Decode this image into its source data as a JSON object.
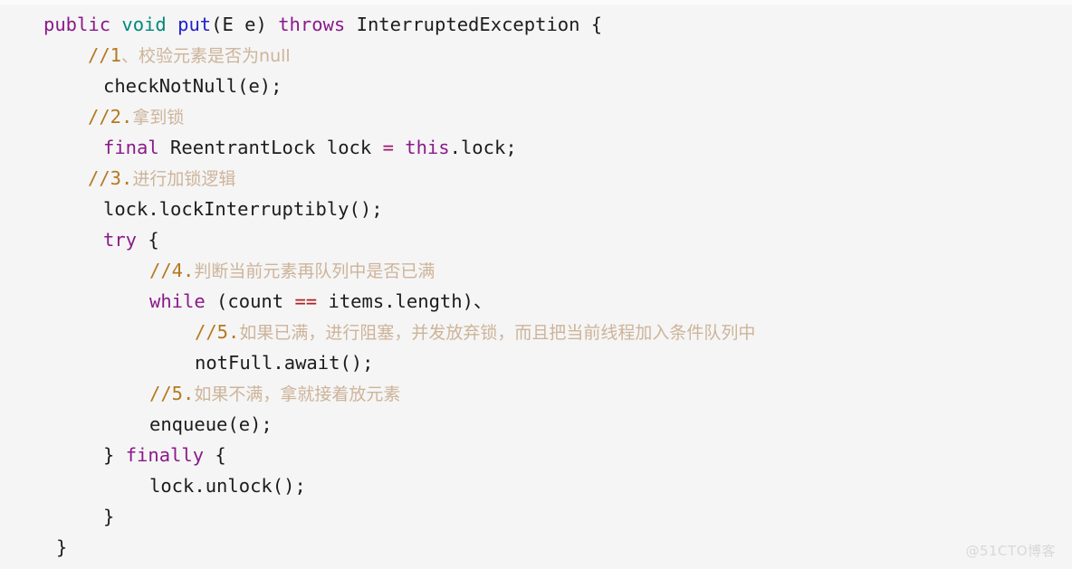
{
  "document": {
    "kind": "code-snippet-screenshot",
    "language": "Java",
    "background_color": "#f5f5f5",
    "watermark": "@51CTO博客"
  },
  "colors": {
    "keyword": "#8b1a8b",
    "type_keyword": "#00897b",
    "method": "#2222cc",
    "plain": "#1c1c1c",
    "operator": "#9b1b6e",
    "comparison": "#b02020",
    "comment_marker": "#b5791f",
    "comment_cjk": "#cdb49a",
    "watermark": "#d8d8d8"
  },
  "code": {
    "lines": [
      {
        "id": "line-1",
        "indent": 48,
        "text": "public void put(E e) throws InterruptedException {",
        "tokens": [
          {
            "t": "public",
            "c": "kw"
          },
          {
            "t": " ",
            "c": "plain"
          },
          {
            "t": "void",
            "c": "type-kw"
          },
          {
            "t": " ",
            "c": "plain"
          },
          {
            "t": "put",
            "c": "method"
          },
          {
            "t": "(E e) ",
            "c": "plain"
          },
          {
            "t": "throws",
            "c": "kw"
          },
          {
            "t": " InterruptedException {",
            "c": "plain"
          }
        ]
      },
      {
        "id": "line-2",
        "indent": 97,
        "text": "//1、校验元素是否为null",
        "tokens": [
          {
            "t": "//1",
            "c": "comment-num"
          },
          {
            "t": "、校验元素是否为",
            "c": "comment-cjk"
          },
          {
            "t": "null",
            "c": "comment-cjk"
          }
        ]
      },
      {
        "id": "line-3",
        "indent": 114,
        "text": "checkNotNull(e);",
        "tokens": [
          {
            "t": "checkNotNull(e);",
            "c": "plain"
          }
        ]
      },
      {
        "id": "line-4",
        "indent": 97,
        "text": "//2.拿到锁",
        "tokens": [
          {
            "t": "//2.",
            "c": "comment-num"
          },
          {
            "t": "拿到锁",
            "c": "comment-cjk"
          }
        ]
      },
      {
        "id": "line-5",
        "indent": 114,
        "text": "final ReentrantLock lock = this.lock;",
        "tokens": [
          {
            "t": "final",
            "c": "kw"
          },
          {
            "t": " ReentrantLock lock ",
            "c": "plain"
          },
          {
            "t": "=",
            "c": "op"
          },
          {
            "t": " ",
            "c": "plain"
          },
          {
            "t": "this",
            "c": "kw"
          },
          {
            "t": ".lock;",
            "c": "plain"
          }
        ]
      },
      {
        "id": "line-6",
        "indent": 97,
        "text": "//3.进行加锁逻辑",
        "tokens": [
          {
            "t": "//3.",
            "c": "comment-num"
          },
          {
            "t": "进行加锁逻辑",
            "c": "comment-cjk"
          }
        ]
      },
      {
        "id": "line-7",
        "indent": 114,
        "text": "lock.lockInterruptibly();",
        "tokens": [
          {
            "t": "lock.lockInterruptibly();",
            "c": "plain"
          }
        ]
      },
      {
        "id": "line-8",
        "indent": 114,
        "text": "try {",
        "tokens": [
          {
            "t": "try",
            "c": "kw"
          },
          {
            "t": " {",
            "c": "plain"
          }
        ]
      },
      {
        "id": "line-9",
        "indent": 165,
        "text": "//4.判断当前元素再队列中是否已满",
        "tokens": [
          {
            "t": "//4.",
            "c": "comment-num"
          },
          {
            "t": "判断当前元素再队列中是否已满",
            "c": "comment-cjk"
          }
        ]
      },
      {
        "id": "line-10",
        "indent": 165,
        "text": "while (count == items.length)、",
        "tokens": [
          {
            "t": "while",
            "c": "kw"
          },
          {
            "t": " (count ",
            "c": "plain"
          },
          {
            "t": "==",
            "c": "cmp"
          },
          {
            "t": " items.length)",
            "c": "plain"
          },
          {
            "t": "、",
            "c": "plain"
          }
        ]
      },
      {
        "id": "line-11",
        "indent": 215,
        "text": "//5.如果已满，进行阻塞，并发放弃锁，而且把当前线程加入条件队列中",
        "tokens": [
          {
            "t": "//5.",
            "c": "comment-num"
          },
          {
            "t": "如果已满，进行阻塞，并发放弃锁，而且把当前线程加入条件队列中",
            "c": "comment-cjk"
          }
        ]
      },
      {
        "id": "line-12",
        "indent": 215,
        "text": "notFull.await();",
        "tokens": [
          {
            "t": "notFull.await();",
            "c": "plain"
          }
        ]
      },
      {
        "id": "line-13",
        "indent": 165,
        "text": "//5.如果不满，拿就接着放元素",
        "tokens": [
          {
            "t": "//5.",
            "c": "comment-num"
          },
          {
            "t": "如果不满，拿就接着放元素",
            "c": "comment-cjk"
          }
        ]
      },
      {
        "id": "line-14",
        "indent": 165,
        "text": "enqueue(e);",
        "tokens": [
          {
            "t": "enqueue(e);",
            "c": "plain"
          }
        ]
      },
      {
        "id": "line-15",
        "indent": 114,
        "text": "} finally {",
        "tokens": [
          {
            "t": "} ",
            "c": "plain"
          },
          {
            "t": "finally",
            "c": "kw"
          },
          {
            "t": " {",
            "c": "plain"
          }
        ]
      },
      {
        "id": "line-16",
        "indent": 165,
        "text": "lock.unlock();",
        "tokens": [
          {
            "t": "lock.unlock();",
            "c": "plain"
          }
        ]
      },
      {
        "id": "line-17",
        "indent": 114,
        "text": "}",
        "tokens": [
          {
            "t": "}",
            "c": "plain"
          }
        ]
      },
      {
        "id": "line-18",
        "indent": 62,
        "text": "}",
        "tokens": [
          {
            "t": "}",
            "c": "plain"
          }
        ]
      }
    ]
  }
}
